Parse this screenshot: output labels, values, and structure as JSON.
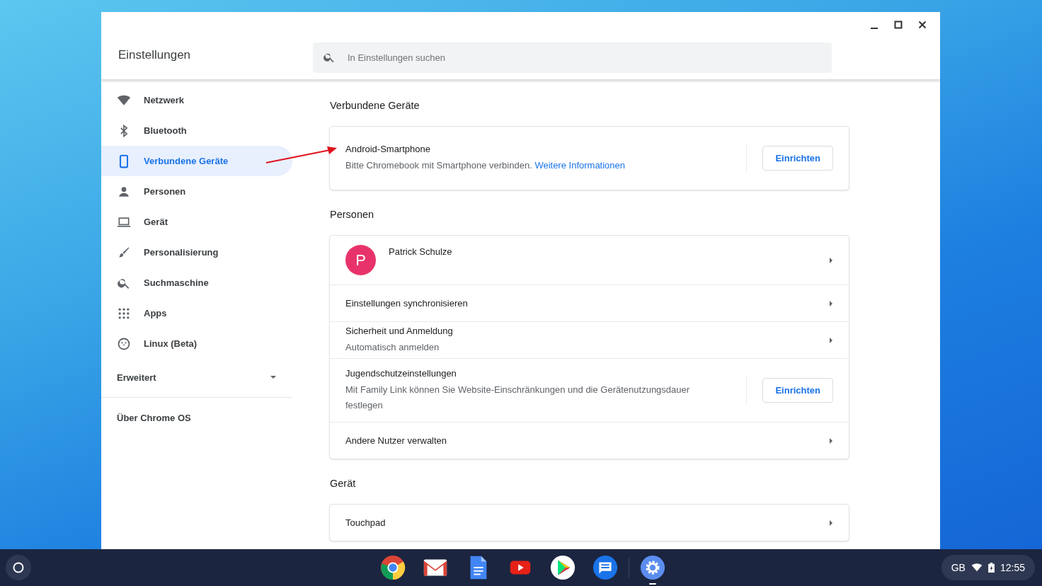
{
  "window": {
    "title": "Einstellungen",
    "search": {
      "placeholder": "In Einstellungen suchen"
    }
  },
  "sidebar": {
    "items": [
      {
        "kind": "network",
        "label": "Netzwerk",
        "selected": false
      },
      {
        "kind": "bluetooth",
        "label": "Bluetooth",
        "selected": false
      },
      {
        "kind": "devices",
        "label": "Verbundene Geräte",
        "selected": true
      },
      {
        "kind": "people",
        "label": "Personen",
        "selected": false
      },
      {
        "kind": "device",
        "label": "Gerät",
        "selected": false
      },
      {
        "kind": "personalize",
        "label": "Personalisierung",
        "selected": false
      },
      {
        "kind": "search",
        "label": "Suchmaschine",
        "selected": false
      },
      {
        "kind": "apps",
        "label": "Apps",
        "selected": false
      },
      {
        "kind": "linux",
        "label": "Linux (Beta)",
        "selected": false
      }
    ],
    "advanced": {
      "label": "Erweitert",
      "expanded": false
    },
    "about": "Über Chrome OS"
  },
  "sections": [
    {
      "heading": "Verbundene Geräte",
      "rows": [
        {
          "kind": "action",
          "title": "Android-Smartphone",
          "subtitle": "Bitte Chromebook mit Smartphone verbinden.",
          "link": "Weitere Informationen",
          "button": "Einrichten"
        }
      ]
    },
    {
      "heading": "Personen",
      "rows": [
        {
          "kind": "account",
          "initial": "P",
          "title": "Patrick Schulze"
        },
        {
          "kind": "link",
          "title": "Einstellungen synchronisieren"
        },
        {
          "kind": "link",
          "title": "Sicherheit und Anmeldung",
          "subtitle": "Automatisch anmelden"
        },
        {
          "kind": "action",
          "title": "Jugendschutzeinstellungen",
          "subtitle": "Mit Family Link können Sie Website-Einschränkungen und die Gerätenutzungsdauer festlegen",
          "button": "Einrichten"
        },
        {
          "kind": "link",
          "title": "Andere Nutzer verwalten"
        }
      ]
    },
    {
      "heading": "Gerät",
      "rows": [
        {
          "kind": "link",
          "title": "Touchpad"
        }
      ]
    }
  ],
  "shelf": {
    "apps": [
      {
        "kind": "chrome",
        "active": false
      },
      {
        "kind": "gmail",
        "active": false
      },
      {
        "kind": "docs",
        "active": false
      },
      {
        "kind": "youtube",
        "active": false
      },
      {
        "kind": "play",
        "active": false
      },
      {
        "kind": "messages",
        "active": false
      },
      {
        "kind": "settings",
        "active": true
      }
    ],
    "tray": {
      "keyboard": "GB",
      "time": "12:55"
    }
  }
}
